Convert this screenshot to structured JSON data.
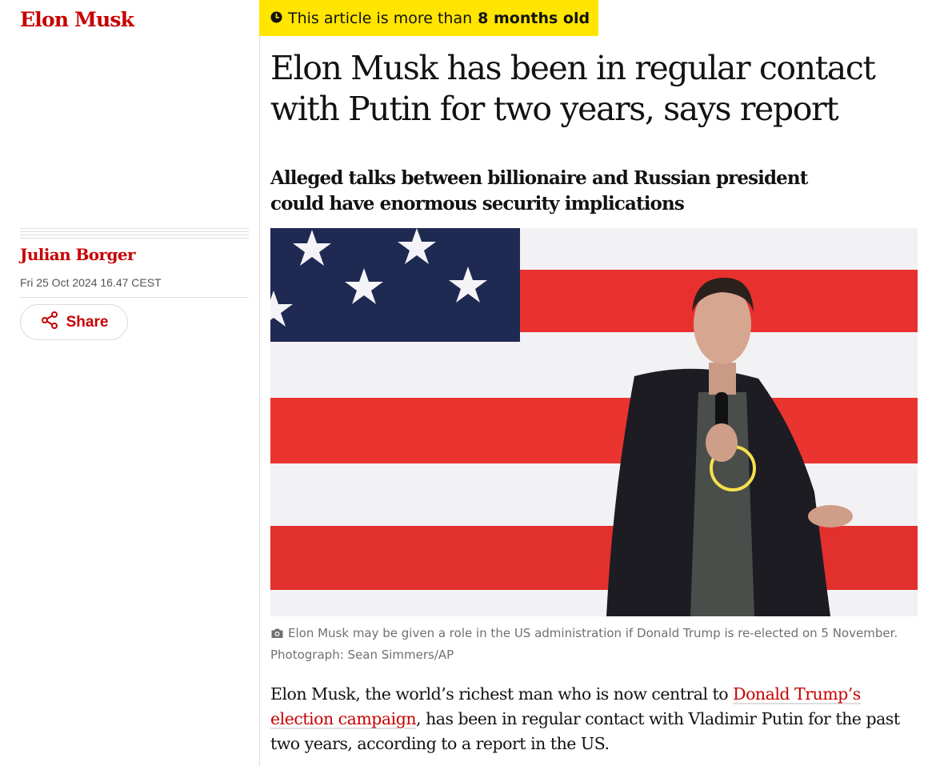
{
  "section": {
    "tag": "Elon Musk"
  },
  "age_warning": {
    "prefix": "This article is more than",
    "age": "8 months old",
    "icon": "clock-icon"
  },
  "article": {
    "headline": "Elon Musk has been in regular contact with Putin for two years, says report",
    "standfirst": "Alleged talks between billionaire and Russian president could have enormous security implications",
    "byline": "Julian Borger",
    "dateline": "Fri 25 Oct 2024 16.47 CEST",
    "share_label": "Share",
    "caption": {
      "icon": "camera-icon",
      "text": "Elon Musk may be given a role in the US administration if Donald Trump is re-elected on 5 November. Photograph: Sean Simmers/AP"
    },
    "body": {
      "before_link": "Elon Musk, the world’s richest man who is now central to ",
      "link_text": "Donald Trump’s election campaign",
      "after_link": ", has been in regular contact with Vladimir Putin for the past two years, according to a report in the US."
    }
  },
  "colors": {
    "brand_red": "#c70000",
    "badge_yellow": "#ffe500",
    "text": "#121212",
    "muted": "#707070",
    "rule": "#dcdcdc"
  }
}
